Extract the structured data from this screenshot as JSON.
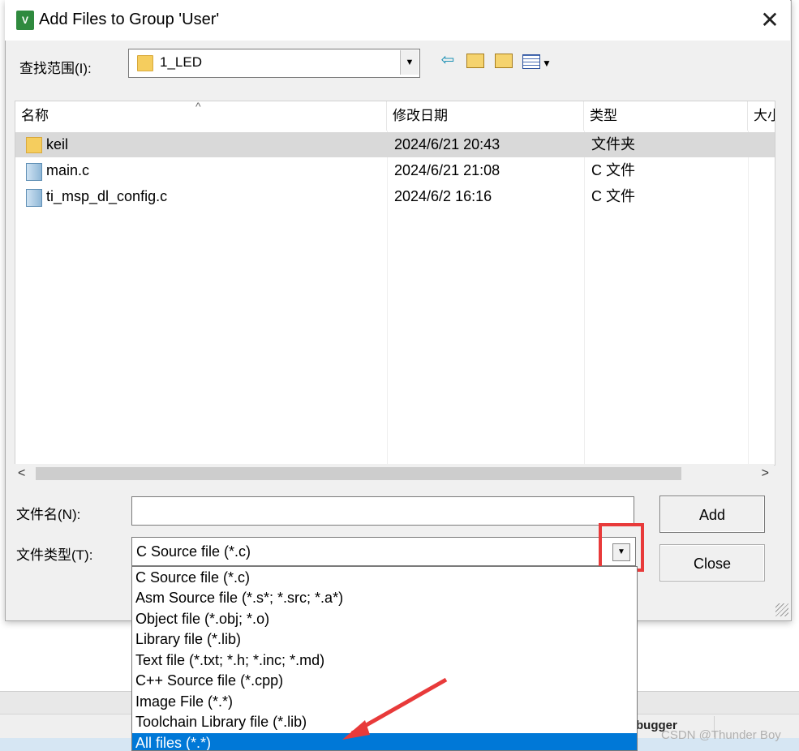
{
  "dialog": {
    "title": "Add Files to Group 'User'",
    "logo_text": "V",
    "close_glyph": "✕"
  },
  "look_in": {
    "label": "查找范围(I):",
    "value": "1_LED"
  },
  "toolbar": {
    "back_icon": "back-arrow-icon",
    "up_icon": "up-folder-icon",
    "new_folder_icon": "new-folder-icon",
    "view_menu_icon": "view-menu-icon"
  },
  "file_list": {
    "columns": [
      "名称",
      "修改日期",
      "类型",
      "大小"
    ],
    "rows": [
      {
        "name": "keil",
        "modified": "2024/6/21 20:43",
        "type": "文件夹",
        "icon": "folder-icon",
        "selected": true
      },
      {
        "name": "main.c",
        "modified": "2024/6/21 21:08",
        "type": "C 文件",
        "icon": "c-file-icon",
        "selected": false
      },
      {
        "name": "ti_msp_dl_config.c",
        "modified": "2024/6/2 16:16",
        "type": "C 文件",
        "icon": "c-file-icon",
        "selected": false
      }
    ]
  },
  "file_name": {
    "label": "文件名(N):",
    "value": ""
  },
  "file_type": {
    "label": "文件类型(T):",
    "value": "C Source file (*.c)",
    "options": [
      "C Source file (*.c)",
      "Asm Source file (*.s*; *.src; *.a*)",
      "Object file (*.obj; *.o)",
      "Library file (*.lib)",
      "Text file (*.txt; *.h; *.inc; *.md)",
      "C++ Source file (*.cpp)",
      "Image File (*.*)",
      "Toolchain Library file (*.lib)",
      "All files (*.*)"
    ],
    "highlighted_option_index": 8
  },
  "buttons": {
    "add": "Add",
    "close": "Close"
  },
  "background_app": {
    "status_text": "bugger"
  },
  "watermark": "CSDN @Thunder Boy",
  "colors": {
    "selection_blue": "#0078d7",
    "annotation_red": "#e83a3a",
    "row_selected": "#d9d9d9"
  }
}
